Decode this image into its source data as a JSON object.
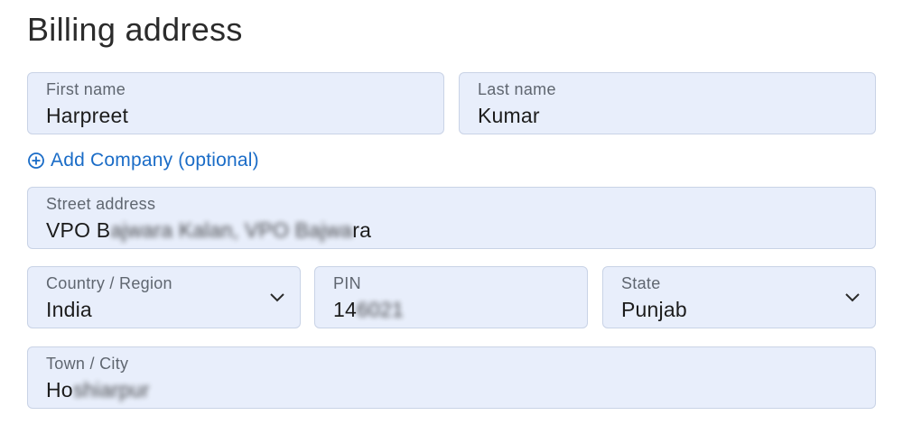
{
  "section_title": "Billing address",
  "first_name": {
    "label": "First name",
    "value": "Harpreet"
  },
  "last_name": {
    "label": "Last name",
    "value": "Kumar"
  },
  "add_company": {
    "label": "Add Company (optional)",
    "icon": "plus-circle-icon"
  },
  "street_address": {
    "label": "Street address",
    "value_visible_prefix": "VPO B",
    "value_blurred": "ajwara Kalan, VPO Bajwa",
    "value_visible_suffix": "ra"
  },
  "country_region": {
    "label": "Country / Region",
    "value": "India",
    "icon": "chevron-down-icon"
  },
  "pin": {
    "label": "PIN",
    "value_visible": "14",
    "value_blurred": "6021"
  },
  "state": {
    "label": "State",
    "value": "Punjab",
    "icon": "chevron-down-icon"
  },
  "town_city": {
    "label": "Town / City",
    "value_visible": "Ho",
    "value_blurred": "shiarpur"
  },
  "colors": {
    "field_background": "#e8eefb",
    "field_border": "#c9d3e6",
    "link": "#1a6cc7"
  }
}
